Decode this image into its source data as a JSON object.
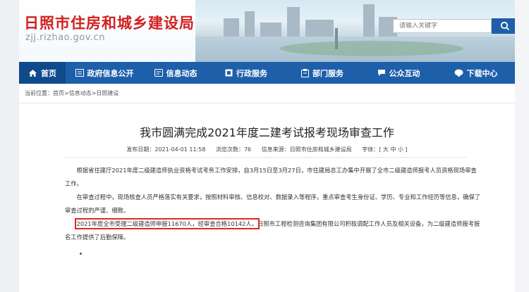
{
  "header": {
    "site_title": "日照市住房和城乡建设局",
    "domain": "zjj.rizhao.gov.cn",
    "search_placeholder": "请输入关键字"
  },
  "nav": {
    "items": [
      {
        "label": "首页",
        "icon": "home-icon"
      },
      {
        "label": "政府信息公开",
        "icon": "list-icon"
      },
      {
        "label": "信息动态",
        "icon": "newspaper-icon"
      },
      {
        "label": "行政服务",
        "icon": "flag-icon"
      },
      {
        "label": "部门服务",
        "icon": "clipboard-icon"
      },
      {
        "label": "公众互动",
        "icon": "chat-icon"
      },
      {
        "label": "下载中心",
        "icon": "download-icon"
      }
    ]
  },
  "breadcrumb": "当前位置：首页>信息动态>日照建设",
  "article": {
    "title": "我市圆满完成2021年度二建考试报考现场审查工作",
    "publish_date": "发布日期：2021-04-01 11:58",
    "views": "浏览次数：76",
    "source": "信息来源：日照市住房和城乡建设局",
    "font_size": "字体：[ 大 中 小 ]",
    "p1": "根据省住建厅2021年度二级建造师执业资格考试考务工作安排，自3月15日至3月27日，市住建局总工办集中开展了全市二级建造师报考人员资格现场审查工作。",
    "p2": "在审查过程中，现场核查人员严格落实有关要求，按照材料审核、信息校对、数据录入等程序，重点审查考生身份证、学历、专业和工作经历等信息，确保了审查过程的严谨、细致。",
    "p3_highlight": "2021年度全市受理二级建造师申报11670人，经审查合格10142人。",
    "p3_rest": "日照市工程检测咨询集团有限公司积极调配工作人员及相关设备，为二级建造师报考报名工作提供了后勤保障。"
  },
  "colors": {
    "nav_bg": "#1d5fa9",
    "title_red": "#d21f1f",
    "highlight_border": "#e0262b"
  }
}
